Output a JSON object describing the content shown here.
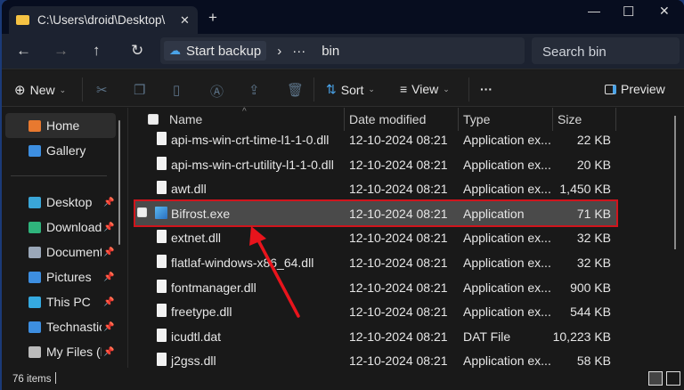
{
  "window": {
    "tab_title": "C:\\Users\\droid\\Desktop\\",
    "tab_close": "✕",
    "new_tab": "+",
    "minimize": "—",
    "maximize": "☐",
    "close": "✕"
  },
  "address": {
    "back": "←",
    "forward": "→",
    "up": "↑",
    "refresh": "↻",
    "backup_label": "Start backup",
    "chevron": "›",
    "ellipsis": "···",
    "current": "bin",
    "search_placeholder": "Search bin"
  },
  "toolbar": {
    "new_label": "New",
    "sort_label": "Sort",
    "view_label": "View",
    "more": "···",
    "preview_label": "Preview"
  },
  "sidebar": {
    "items": [
      {
        "label": "Home",
        "color": "#e8792f",
        "pinned": false
      },
      {
        "label": "Gallery",
        "color": "#3d8ee0",
        "pinned": false
      },
      {
        "label": "Desktop",
        "color": "#3aa6d8",
        "pinned": true
      },
      {
        "label": "Downloads",
        "color": "#2fb47c",
        "pinned": true
      },
      {
        "label": "Documents",
        "color": "#9aa7b8",
        "pinned": true
      },
      {
        "label": "Pictures",
        "color": "#3d8ee0",
        "pinned": true
      },
      {
        "label": "This PC",
        "color": "#35a9e0",
        "pinned": true
      },
      {
        "label": "Technastic",
        "color": "#3d8ee0",
        "pinned": true
      },
      {
        "label": "My Files (D:)",
        "color": "#bbbbbb",
        "pinned": true
      }
    ]
  },
  "columns": {
    "name": "Name",
    "date": "Date modified",
    "type": "Type",
    "size": "Size"
  },
  "files": [
    {
      "name": "api-ms-win-crt-time-l1-1-0.dll",
      "date": "12-10-2024 08:21",
      "type": "Application ex...",
      "size": "22 KB",
      "icon": "dll"
    },
    {
      "name": "api-ms-win-crt-utility-l1-1-0.dll",
      "date": "12-10-2024 08:21",
      "type": "Application ex...",
      "size": "20 KB",
      "icon": "dll"
    },
    {
      "name": "awt.dll",
      "date": "12-10-2024 08:21",
      "type": "Application ex...",
      "size": "1,450 KB",
      "icon": "dll"
    },
    {
      "name": "Bifrost.exe",
      "date": "12-10-2024 08:21",
      "type": "Application",
      "size": "71 KB",
      "icon": "exe",
      "selected": true
    },
    {
      "name": "extnet.dll",
      "date": "12-10-2024 08:21",
      "type": "Application ex...",
      "size": "32 KB",
      "icon": "dll"
    },
    {
      "name": "flatlaf-windows-x86_64.dll",
      "date": "12-10-2024 08:21",
      "type": "Application ex...",
      "size": "32 KB",
      "icon": "dll"
    },
    {
      "name": "fontmanager.dll",
      "date": "12-10-2024 08:21",
      "type": "Application ex...",
      "size": "900 KB",
      "icon": "dll"
    },
    {
      "name": "freetype.dll",
      "date": "12-10-2024 08:21",
      "type": "Application ex...",
      "size": "544 KB",
      "icon": "dll"
    },
    {
      "name": "icudtl.dat",
      "date": "12-10-2024 08:21",
      "type": "DAT File",
      "size": "10,223 KB",
      "icon": "file"
    },
    {
      "name": "j2gss.dll",
      "date": "12-10-2024 08:21",
      "type": "Application ex...",
      "size": "58 KB",
      "icon": "dll"
    }
  ],
  "status": {
    "item_count": "76 items"
  },
  "annotation": {
    "color": "#e8141c"
  }
}
